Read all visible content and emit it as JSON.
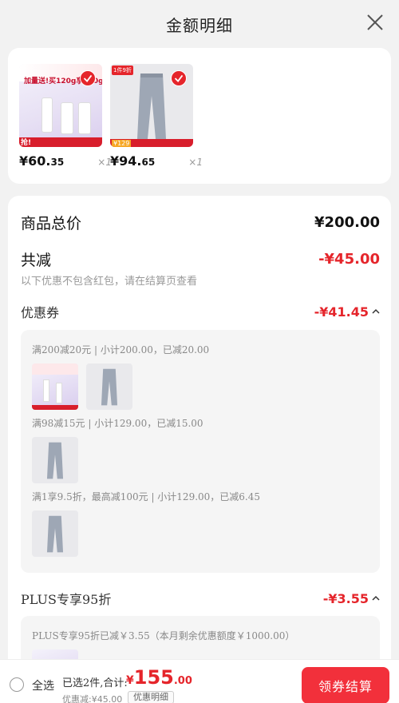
{
  "header": {
    "title": "金额明细"
  },
  "products": [
    {
      "image_text": "加量送!买120g享220g",
      "tag": "抢!",
      "price_int": "¥60.",
      "price_dec": "35",
      "qty": "×1"
    },
    {
      "image_text": "1件9折",
      "tag": "¥129",
      "price_int": "¥94.",
      "price_dec": "65",
      "qty": "×1"
    }
  ],
  "summary": {
    "total_label": "商品总价",
    "total_value": "¥200.00",
    "reduce_label": "共减",
    "reduce_value": "-¥45.00",
    "reduce_hint": "以下优惠不包含红包，请在结算页查看"
  },
  "coupon": {
    "label": "优惠券",
    "value": "-¥41.45",
    "lines": [
      "满200减20元 | 小计200.00，已减20.00",
      "满98减15元 | 小计129.00，已减15.00",
      "满1享9.5折，最高减100元 | 小计129.00，已减6.45"
    ]
  },
  "plus": {
    "label": "PLUS专享95折",
    "value": "-¥3.55",
    "line": "PLUS专享95折已减￥3.55（本月剩余优惠额度￥1000.00）"
  },
  "footer": {
    "select_all": "全选",
    "selected_info": "已选2件,合计:",
    "total_sym": "¥",
    "total_int": "155",
    "total_dec": ".00",
    "discount": "优惠减:¥45.00",
    "detail_label": "优惠明细",
    "checkout_label": "领券结算"
  },
  "colors": {
    "accent": "#e5252b",
    "checkout_bg": "#f2303b"
  }
}
